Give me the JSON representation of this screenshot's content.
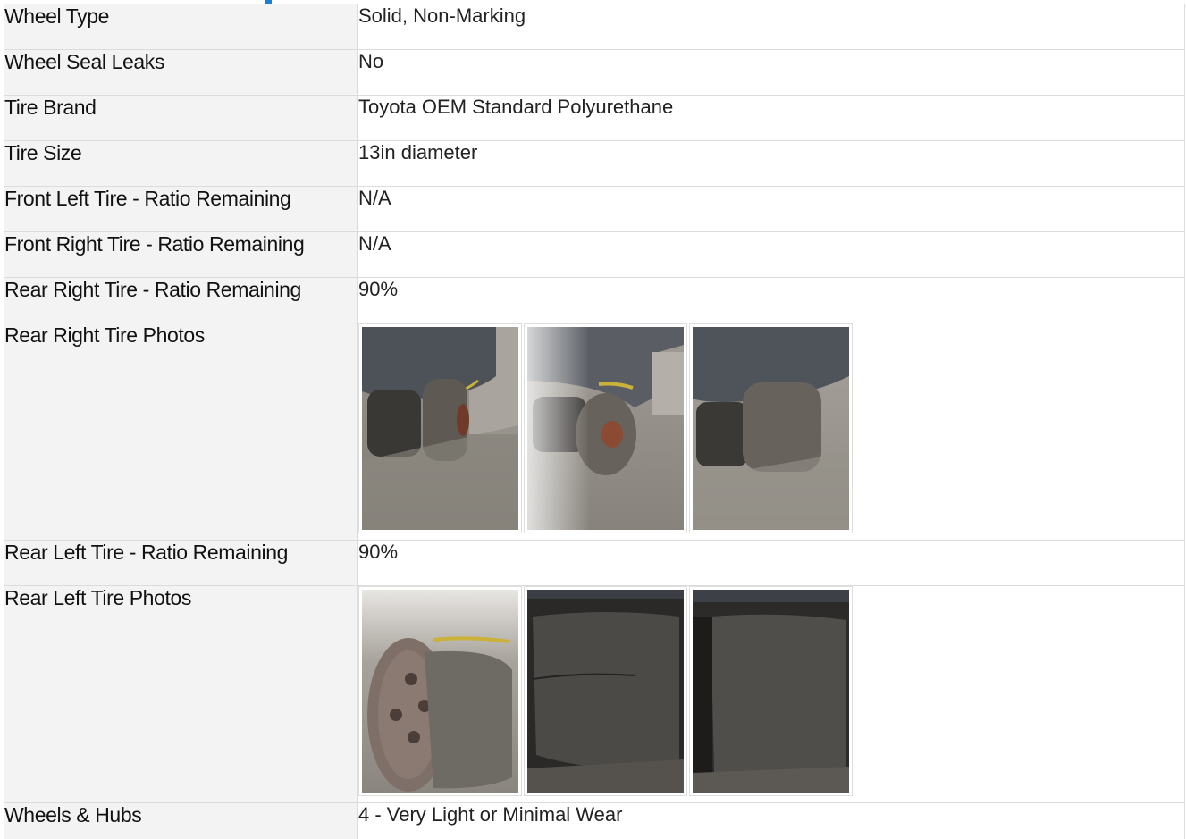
{
  "rows": [
    {
      "label": "Wheel Type",
      "value": "Solid, Non-Marking"
    },
    {
      "label": "Wheel Seal Leaks",
      "value": "No"
    },
    {
      "label": "Tire Brand",
      "value": "Toyota OEM Standard Polyurethane"
    },
    {
      "label": "Tire Size",
      "value": "13in diameter"
    },
    {
      "label": "Front Left Tire - Ratio Remaining",
      "value": "N/A"
    },
    {
      "label": "Front Right Tire - Ratio Remaining",
      "value": "N/A"
    },
    {
      "label": "Rear Right Tire - Ratio Remaining",
      "value": "90%"
    }
  ],
  "rear_right_photos": {
    "label": "Rear Right Tire Photos",
    "photos": [
      "tire-photo",
      "tire-photo",
      "tire-photo"
    ]
  },
  "rear_left_ratio": {
    "label": "Rear Left Tire - Ratio Remaining",
    "value": "90%"
  },
  "rear_left_photos": {
    "label": "Rear Left Tire Photos",
    "photos": [
      "tire-photo",
      "tire-photo",
      "tire-photo"
    ]
  },
  "wheels_hubs": {
    "label": "Wheels & Hubs",
    "value": "4 - Very Light or Minimal Wear"
  },
  "colors": {
    "accent": "#1a7fd4",
    "label_bg": "#f3f3f3",
    "border": "#dcdcdc"
  }
}
